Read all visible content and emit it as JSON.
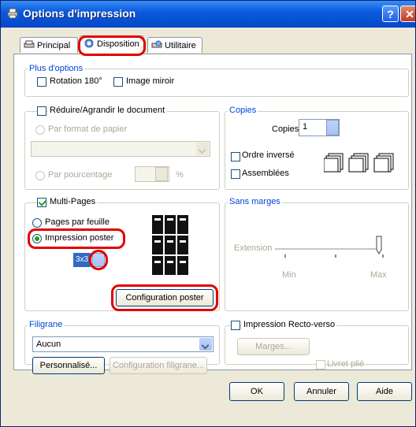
{
  "window": {
    "title": "Options d'impression"
  },
  "tabs": [
    {
      "label": "Principal",
      "icon": "printer-icon"
    },
    {
      "label": "Disposition",
      "icon": "layout-icon",
      "active": true
    },
    {
      "label": "Utilitaire",
      "icon": "utility-icon"
    }
  ],
  "plus_options": {
    "label": "Plus d'options",
    "rotation": "Rotation 180°",
    "mirror": "Image miroir"
  },
  "reduce": {
    "label": "Réduire/Agrandir le document",
    "by_paper": "Par format de papier",
    "by_percent": "Par pourcentage",
    "percent_sign": "%"
  },
  "copies": {
    "label": "Copies",
    "copies_label": "Copies",
    "copies_value": "1",
    "reverse": "Ordre inversé",
    "collate": "Assemblées"
  },
  "multipages": {
    "label": "Multi-Pages",
    "pages_per_sheet": "Pages par feuille",
    "poster": "Impression poster",
    "poster_value": "3x3",
    "config_button": "Configuration poster"
  },
  "borderless": {
    "label": "Sans marges",
    "extension": "Extension",
    "min": "Min",
    "max": "Max",
    "level": 1.0
  },
  "watermark": {
    "label": "Filigrane",
    "value": "Aucun",
    "customize_button": "Personnalisé...",
    "config_button": "Configuration filigrane..."
  },
  "duplex": {
    "label": "Impression Recto-verso",
    "margins_button": "Marges...",
    "booklet": "Livret plié"
  },
  "footer": {
    "ok": "OK",
    "cancel": "Annuler",
    "help": "Aide"
  },
  "colors": {
    "highlight": "#e30000",
    "group_label": "#0046d5",
    "titlebar": "#0548c8"
  }
}
